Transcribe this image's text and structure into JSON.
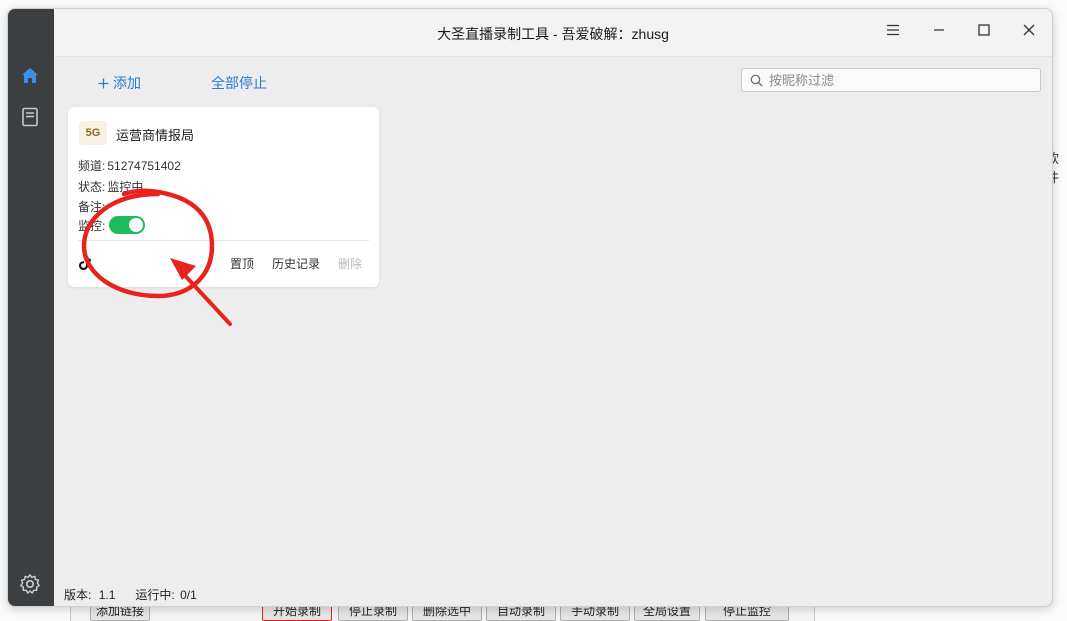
{
  "background_app": {
    "edge_text": "软件",
    "buttons": [
      "添加链接",
      "开始录制",
      "停止录制",
      "删除选中",
      "自动录制",
      "手动录制",
      "全局设置",
      "停止监控"
    ]
  },
  "window": {
    "title": "大圣直播录制工具 - 吾爱破解：zhusg",
    "controls": {
      "menu": "menu-icon",
      "minimize": "minimize-icon",
      "maximize": "maximize-icon",
      "close": "close-icon"
    }
  },
  "sidebar": {
    "items": [
      {
        "icon": "home-icon",
        "active": true
      },
      {
        "icon": "document-icon",
        "active": false
      }
    ],
    "settings_icon": "gear-icon"
  },
  "toolbar": {
    "add_label": "添加",
    "stop_all_label": "全部停止",
    "search_placeholder": "按昵称过滤"
  },
  "card": {
    "avatar_text": "5G",
    "name": "运营商情报局",
    "channel_label": "频道:",
    "channel_value": "51274751402",
    "status_label": "状态:",
    "status_value": "监控中...",
    "note_label": "备注:",
    "monitor_label": "监控:",
    "monitor_on": true,
    "platform_icon": "tiktok-icon",
    "actions": {
      "pin": "置顶",
      "history": "历史记录",
      "delete": "删除"
    }
  },
  "statusbar": {
    "version_label": "版本:",
    "version_value": "1.1",
    "running_label": "运行中:",
    "running_value": "0/1"
  },
  "colors": {
    "accent": "#2a7bd6",
    "sidebar": "#3c3f41",
    "toggle_on": "#1fba5d",
    "annotation": "#e8231d"
  }
}
